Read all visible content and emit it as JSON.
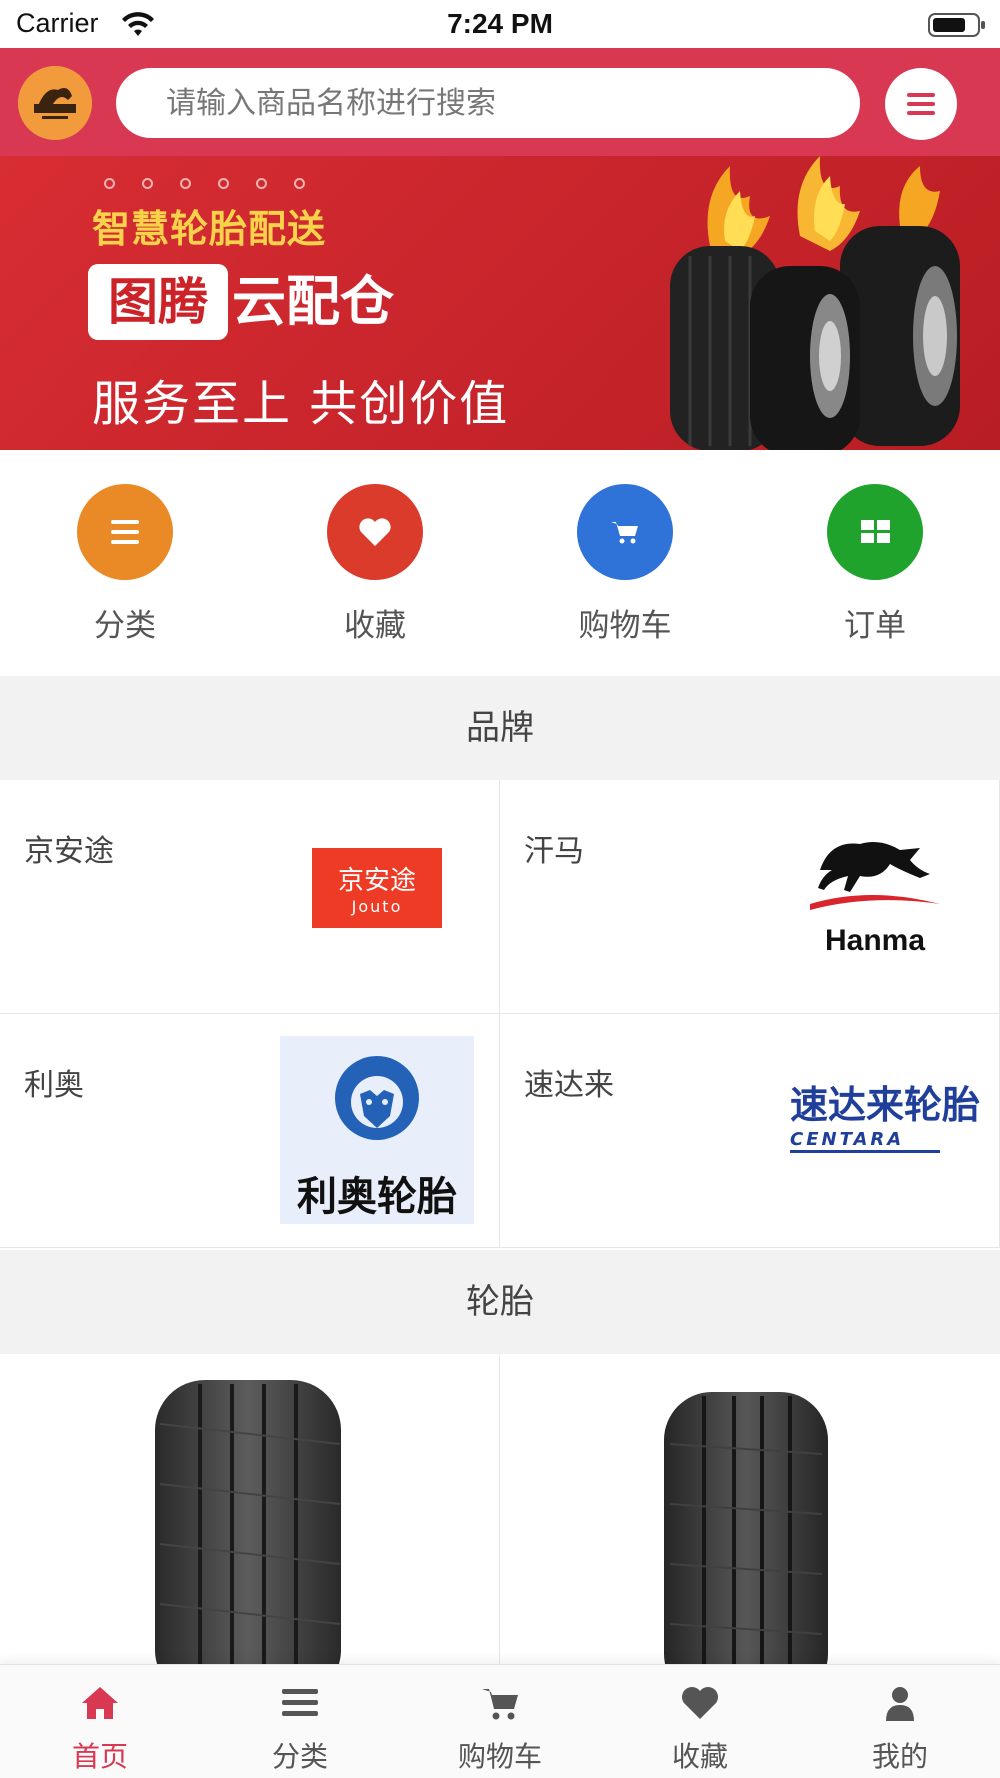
{
  "status_bar": {
    "carrier": "Carrier",
    "time": "7:24 PM"
  },
  "header": {
    "search_placeholder": "请输入商品名称进行搜索",
    "logo_icon": "shop-logo-icon",
    "menu_icon": "menu-icon"
  },
  "banner": {
    "subtitle": "智慧轮胎配送",
    "brand_box": "图腾",
    "brand_rest": "云配仓",
    "slogan": "服务至上  共创价值"
  },
  "quick_nav": [
    {
      "label": "分类",
      "icon": "list-icon",
      "color": "#e98a26"
    },
    {
      "label": "收藏",
      "icon": "heart-icon",
      "color": "#db3b2a"
    },
    {
      "label": "购物车",
      "icon": "cart-icon",
      "color": "#2f72d8"
    },
    {
      "label": "订单",
      "icon": "grid-icon",
      "color": "#1fa32d"
    }
  ],
  "sections": {
    "brands": "品牌",
    "tires": "轮胎"
  },
  "brands": [
    {
      "name": "京安途",
      "logo_text": "京安途",
      "logo_sub": "Jouto"
    },
    {
      "name": "汗马",
      "logo_text": "Hanma"
    },
    {
      "name": "利奥",
      "logo_text": "利奥轮胎"
    },
    {
      "name": "速达来",
      "logo_text": "速达来轮胎",
      "logo_sub": "CENTARA"
    }
  ],
  "tabs": [
    {
      "label": "首页",
      "icon": "home-icon",
      "active": true
    },
    {
      "label": "分类",
      "icon": "list-icon"
    },
    {
      "label": "购物车",
      "icon": "cart-icon"
    },
    {
      "label": "收藏",
      "icon": "heart-icon"
    },
    {
      "label": "我的",
      "icon": "user-icon"
    }
  ],
  "colors": {
    "accent": "#d93853",
    "banner": "#c8262c",
    "section_bg": "#f2f2f2"
  }
}
